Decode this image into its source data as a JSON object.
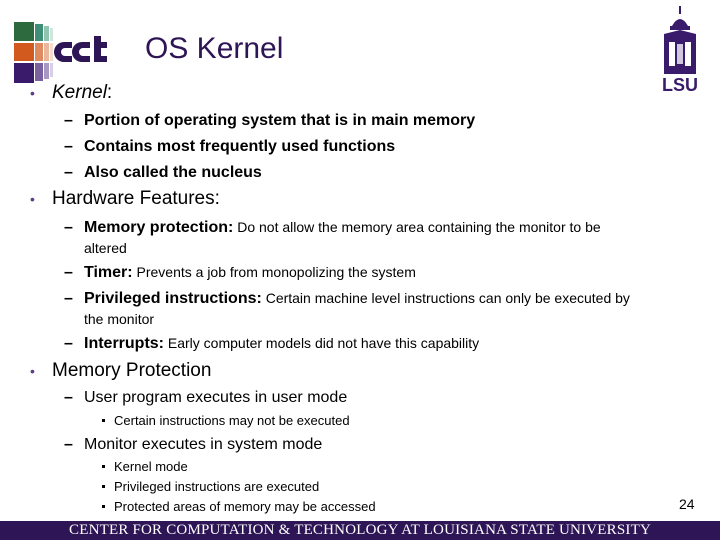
{
  "header": {
    "title": "OS Kernel",
    "logo_left": "cct-logo",
    "logo_right_text": "LSU"
  },
  "bullets": [
    {
      "label": "Kernel",
      "suffix": ":",
      "items": [
        "Portion of operating system that is in main memory",
        "Contains most frequently used functions",
        "Also called the nucleus"
      ]
    },
    {
      "label": "Hardware Features:",
      "items": [
        {
          "term": "Memory protection:",
          "desc": " Do not allow the memory area containing the monitor to be",
          "desc2": "altered"
        },
        {
          "term": "Timer:",
          "desc": " Prevents a job from monopolizing the system"
        },
        {
          "term": "Privileged instructions:",
          "desc": " Certain machine level instructions can only be executed by",
          "desc2": "the monitor"
        },
        {
          "term": "Interrupts:",
          "desc": " Early computer models did not have this capability"
        }
      ]
    },
    {
      "label": "Memory Protection",
      "items": [
        {
          "text": "User program executes in user mode",
          "sub": [
            "Certain instructions may not be executed"
          ]
        },
        {
          "text": "Monitor executes in system mode",
          "sub": [
            "Kernel mode",
            "Privileged instructions are executed",
            "Protected areas of memory may be accessed"
          ]
        }
      ]
    }
  ],
  "page_number": "24",
  "footer": {
    "text": "CENTER FOR COMPUTATION & TECHNOLOGY AT LOUISIANA STATE UNIVERSITY"
  },
  "colors": {
    "brand_purple": "#2e1556",
    "green": "#2d6a3e",
    "orange": "#d35a1f"
  }
}
